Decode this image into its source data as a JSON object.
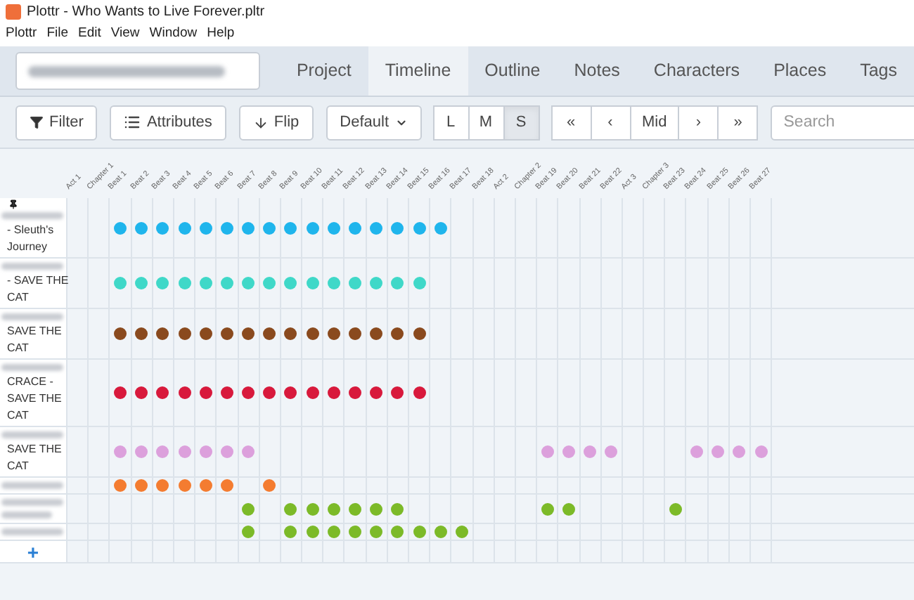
{
  "window": {
    "title": "Plottr - Who Wants to Live Forever.pltr"
  },
  "menu": [
    "Plottr",
    "File",
    "Edit",
    "View",
    "Window",
    "Help"
  ],
  "tabs": [
    {
      "label": "Project",
      "selected": false
    },
    {
      "label": "Timeline",
      "selected": true
    },
    {
      "label": "Outline",
      "selected": false
    },
    {
      "label": "Notes",
      "selected": false
    },
    {
      "label": "Characters",
      "selected": false
    },
    {
      "label": "Places",
      "selected": false
    },
    {
      "label": "Tags",
      "selected": false
    }
  ],
  "toolbar": {
    "filter": "Filter",
    "attributes": "Attributes",
    "flip": "Flip",
    "default": "Default",
    "sizes": [
      {
        "label": "L",
        "selected": false
      },
      {
        "label": "M",
        "selected": false
      },
      {
        "label": "S",
        "selected": true
      }
    ],
    "nav": [
      "«",
      "‹",
      "Mid",
      "›",
      "»"
    ],
    "search": {
      "placeholder": "Search"
    }
  },
  "timeline": {
    "columns": [
      "Act 1",
      "Chapter 1",
      "Beat 1",
      "Beat 2",
      "Beat 3",
      "Beat 4",
      "Beat 5",
      "Beat 6",
      "Beat 7",
      "Beat 8",
      "Beat 9",
      "Beat 10",
      "Beat 11",
      "Beat 12",
      "Beat 13",
      "Beat 14",
      "Beat 15",
      "Beat 16",
      "Beat 17",
      "Beat 18",
      "Act 2",
      "Chapter 2",
      "Beat 19",
      "Beat 20",
      "Beat 21",
      "Beat 22",
      "Act 3",
      "Chapter 3",
      "Beat 23",
      "Beat 24",
      "Beat 25",
      "Beat 26",
      "Beat 27"
    ],
    "rows": [
      {
        "lines": [
          "- Sleuth's",
          "Journey"
        ],
        "pinned": true,
        "color": "#1fb5ec",
        "cards": [
          false,
          false,
          true,
          true,
          true,
          true,
          true,
          true,
          true,
          true,
          true,
          true,
          true,
          true,
          true,
          true,
          true,
          true,
          false,
          false,
          false,
          false,
          false,
          false,
          false,
          false,
          false,
          false,
          false,
          false,
          false,
          false,
          false
        ]
      },
      {
        "lines": [
          "- SAVE THE",
          "CAT"
        ],
        "pinned": false,
        "color": "#3fd8c8",
        "cards": [
          false,
          false,
          true,
          true,
          true,
          true,
          true,
          true,
          true,
          true,
          true,
          true,
          true,
          true,
          true,
          true,
          true,
          false,
          false,
          false,
          false,
          false,
          false,
          false,
          false,
          false,
          false,
          false,
          false,
          false,
          false,
          false,
          false
        ]
      },
      {
        "lines": [
          "SAVE THE",
          "CAT"
        ],
        "pinned": false,
        "color": "#8a4a1e",
        "cards": [
          false,
          false,
          true,
          true,
          true,
          true,
          true,
          true,
          true,
          true,
          true,
          true,
          true,
          true,
          true,
          true,
          true,
          false,
          false,
          false,
          false,
          false,
          false,
          false,
          false,
          false,
          false,
          false,
          false,
          false,
          false,
          false,
          false
        ]
      },
      {
        "lines": [
          "CRACE -",
          "SAVE THE",
          "CAT"
        ],
        "pinned": false,
        "color": "#d8193c",
        "cards": [
          false,
          false,
          true,
          true,
          true,
          true,
          true,
          true,
          true,
          true,
          true,
          true,
          true,
          true,
          true,
          true,
          true,
          false,
          false,
          false,
          false,
          false,
          false,
          false,
          false,
          false,
          false,
          false,
          false,
          false,
          false,
          false,
          false
        ]
      },
      {
        "lines": [
          "SAVE THE",
          "CAT"
        ],
        "pinned": false,
        "color": "#dca0dc",
        "cards": [
          false,
          false,
          true,
          true,
          true,
          true,
          true,
          true,
          true,
          false,
          false,
          false,
          false,
          false,
          false,
          false,
          false,
          false,
          false,
          false,
          false,
          false,
          true,
          true,
          true,
          true,
          false,
          false,
          false,
          true,
          true,
          true,
          true
        ]
      },
      {
        "lines": [],
        "pinned": false,
        "color": "#f47c30",
        "cards": [
          false,
          false,
          true,
          true,
          true,
          true,
          true,
          true,
          false,
          true,
          false,
          false,
          false,
          false,
          false,
          false,
          false,
          false,
          false,
          false,
          false,
          false,
          false,
          false,
          false,
          false,
          false,
          false,
          false,
          false,
          false,
          false,
          false
        ]
      },
      {
        "lines": [],
        "pinned": false,
        "color": "#7cba28",
        "cards": [
          false,
          false,
          false,
          false,
          false,
          false,
          false,
          false,
          true,
          false,
          true,
          true,
          true,
          true,
          true,
          true,
          false,
          false,
          false,
          false,
          false,
          false,
          true,
          true,
          false,
          false,
          false,
          false,
          true,
          false,
          false,
          false,
          false
        ]
      },
      {
        "lines": [],
        "pinned": false,
        "color": "#7cba28",
        "cards": [
          false,
          false,
          false,
          false,
          false,
          false,
          false,
          false,
          true,
          false,
          true,
          true,
          true,
          true,
          true,
          true,
          true,
          true,
          true,
          false,
          false,
          false,
          false,
          false,
          false,
          false,
          false,
          false,
          false,
          false,
          false,
          false,
          false
        ]
      }
    ],
    "add": "+"
  }
}
